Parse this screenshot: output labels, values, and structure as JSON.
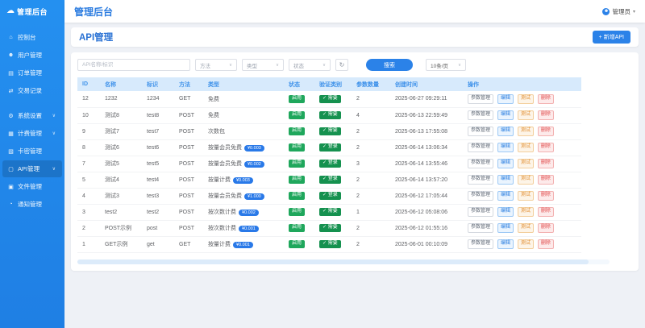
{
  "topbar": {
    "logo": "管理后台",
    "title": "管理后台",
    "user_label": "管理员"
  },
  "sidebar": {
    "items": [
      {
        "key": "console",
        "label": "控制台",
        "icon": "console-icon",
        "chevron": false,
        "active": false,
        "group_start": false
      },
      {
        "key": "users",
        "label": "用户管理",
        "icon": "users-icon",
        "chevron": false,
        "active": false,
        "group_start": false
      },
      {
        "key": "orders",
        "label": "订单管理",
        "icon": "orders-icon",
        "chevron": false,
        "active": false,
        "group_start": false
      },
      {
        "key": "transactions",
        "label": "交易记录",
        "icon": "transactions-icon",
        "chevron": false,
        "active": false,
        "group_start": false
      },
      {
        "key": "settings",
        "label": "系统设置",
        "icon": "settings-icon",
        "chevron": true,
        "active": false,
        "group_start": true
      },
      {
        "key": "billing",
        "label": "计费管理",
        "icon": "billing-icon",
        "chevron": true,
        "active": false,
        "group_start": false
      },
      {
        "key": "cards",
        "label": "卡密管理",
        "icon": "cards-icon",
        "chevron": false,
        "active": false,
        "group_start": false
      },
      {
        "key": "api",
        "label": "API管理",
        "icon": "api-icon",
        "chevron": true,
        "active": true,
        "group_start": false
      },
      {
        "key": "files",
        "label": "文件管理",
        "icon": "files-icon",
        "chevron": false,
        "active": false,
        "group_start": false
      },
      {
        "key": "notify",
        "label": "通知管理",
        "icon": "notify-icon",
        "chevron": false,
        "active": false,
        "group_start": false
      }
    ]
  },
  "page": {
    "title": "API管理",
    "add_button": "+ 新增API"
  },
  "filters": {
    "keyword_placeholder": "API名称/标识",
    "method_select": "方法",
    "type_select": "类型",
    "status_select": "状态",
    "refresh_icon": "refresh-icon",
    "search_button": "搜索",
    "page_size": "10条/页"
  },
  "table": {
    "columns": [
      "ID",
      "名称",
      "标识",
      "方法",
      "类型",
      "状态",
      "验证类别",
      "参数数量",
      "创建时间",
      "操作"
    ],
    "action_labels": {
      "params": "参数管理",
      "edit": "编辑",
      "test": "测试",
      "delete": "删除"
    },
    "rows": [
      {
        "id": "12",
        "name": "1232",
        "slug": "1234",
        "method": "GET",
        "type": "免费",
        "price": "",
        "status": "启用",
        "verify": "需要",
        "params": "2",
        "created": "2025-06-27 09:29:11"
      },
      {
        "id": "10",
        "name": "测试8",
        "slug": "test8",
        "method": "POST",
        "type": "免费",
        "price": "",
        "status": "启用",
        "verify": "需要",
        "params": "4",
        "created": "2025-06-13 22:59:49"
      },
      {
        "id": "9",
        "name": "测试7",
        "slug": "test7",
        "method": "POST",
        "type": "次数包",
        "price": "",
        "status": "启用",
        "verify": "需要",
        "params": "2",
        "created": "2025-06-13 17:55:08"
      },
      {
        "id": "8",
        "name": "测试6",
        "slug": "test6",
        "method": "POST",
        "type": "按量会员免费",
        "price": "¥0.003",
        "status": "启用",
        "verify": "登录",
        "params": "2",
        "created": "2025-06-14 13:06:34"
      },
      {
        "id": "7",
        "name": "测试5",
        "slug": "test5",
        "method": "POST",
        "type": "按量会员免费",
        "price": "¥0.002",
        "status": "启用",
        "verify": "登录",
        "params": "3",
        "created": "2025-06-14 13:55:46"
      },
      {
        "id": "5",
        "name": "测试4",
        "slug": "test4",
        "method": "POST",
        "type": "按量计费",
        "price": "¥0.003",
        "status": "启用",
        "verify": "登录",
        "params": "2",
        "created": "2025-06-14 13:57:20"
      },
      {
        "id": "4",
        "name": "测试3",
        "slug": "test3",
        "method": "POST",
        "type": "按量会员免费",
        "price": "¥1.000",
        "status": "启用",
        "verify": "登录",
        "params": "2",
        "created": "2025-06-12 17:05:44"
      },
      {
        "id": "3",
        "name": "test2",
        "slug": "test2",
        "method": "POST",
        "type": "按次数计费",
        "price": "¥0.002",
        "status": "启用",
        "verify": "需要",
        "params": "1",
        "created": "2025-06-12 05:08:06"
      },
      {
        "id": "2",
        "name": "POST示例",
        "slug": "post",
        "method": "POST",
        "type": "按次数计费",
        "price": "¥0.001",
        "status": "启用",
        "verify": "需要",
        "params": "2",
        "created": "2025-06-12 01:55:16"
      },
      {
        "id": "1",
        "name": "GET示例",
        "slug": "get",
        "method": "GET",
        "type": "按量计费",
        "price": "¥0.001",
        "status": "启用",
        "verify": "需要",
        "params": "2",
        "created": "2025-06-01 00:10:09"
      }
    ]
  },
  "colors": {
    "accent": "#2b82e8",
    "sidebar": "#2185e8",
    "status_green": "#1fa75c",
    "price_blue": "#2979e8",
    "header_band": "#d7eafc"
  }
}
